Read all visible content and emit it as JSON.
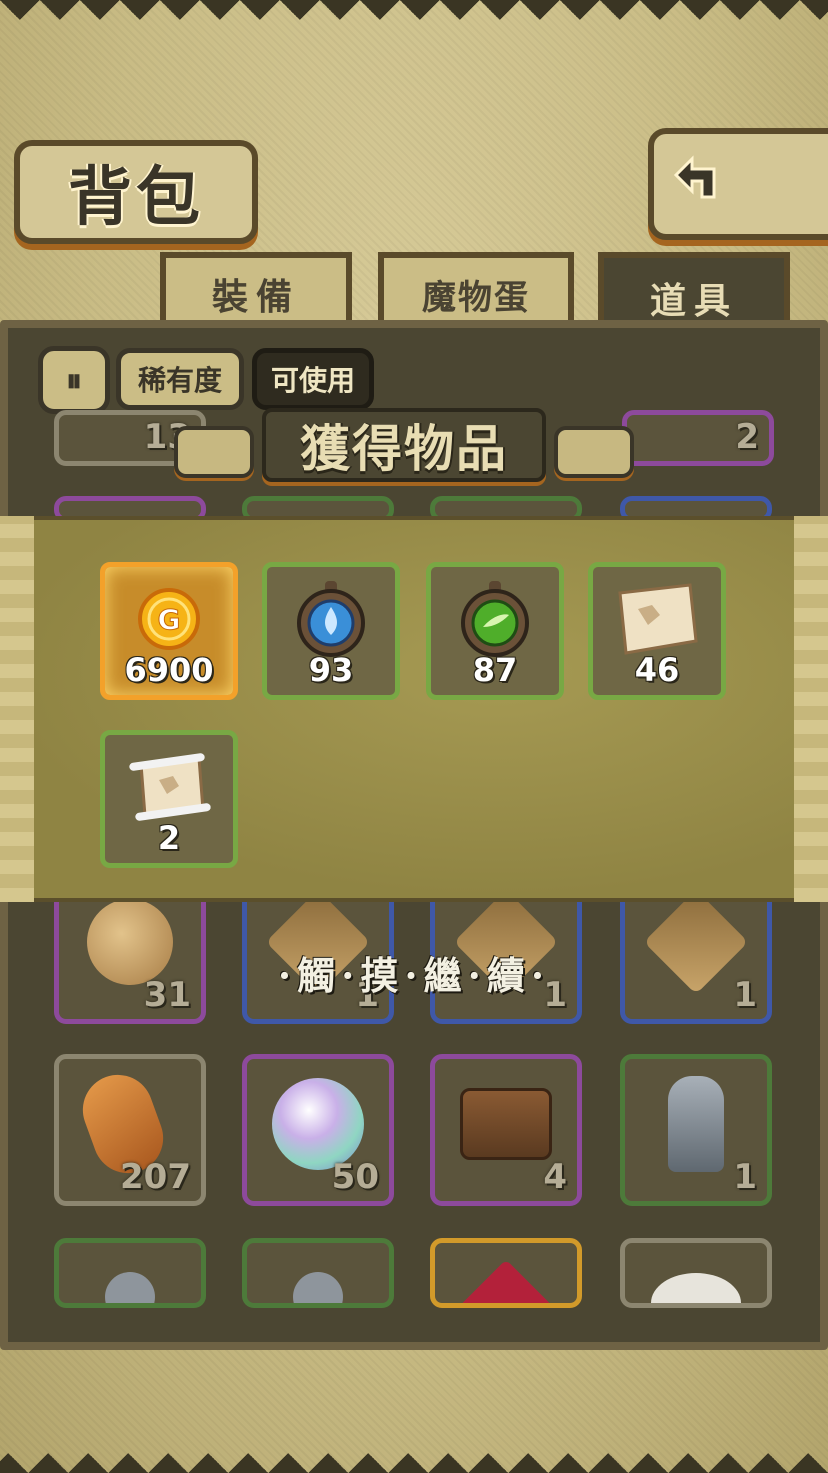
{
  "header": {
    "title": "背包",
    "back_icon": "return-arrow-icon"
  },
  "tabs": [
    {
      "label": "裝備",
      "active": false
    },
    {
      "label": "魔物蛋",
      "active": false
    },
    {
      "label": "道具",
      "active": true
    }
  ],
  "filters": {
    "toggle_icon": "sort-toggle-icon",
    "rarity_label": "稀有度",
    "usable_label": "可使用"
  },
  "inventory": {
    "row_top_partial": [
      {
        "qty": "13",
        "border": "grey"
      },
      {
        "qty": "2",
        "border": "purple"
      }
    ],
    "row_a": [
      {
        "qty": "31",
        "icon": "treasure-sack-icon",
        "border": "purple"
      },
      {
        "qty": "1",
        "icon": "monster-card-icon",
        "border": "blue"
      },
      {
        "qty": "1",
        "icon": "monster-card-icon",
        "border": "blue"
      },
      {
        "qty": "1",
        "icon": "monster-card-icon",
        "border": "blue"
      }
    ],
    "row_b": [
      {
        "qty": "207",
        "icon": "bread-icon",
        "border": "grey"
      },
      {
        "qty": "50",
        "icon": "rainbow-egg-icon",
        "border": "purple"
      },
      {
        "qty": "4",
        "icon": "treasure-chest-icon",
        "border": "purple"
      },
      {
        "qty": "1",
        "icon": "knight-statue-icon",
        "border": "green"
      }
    ],
    "row_c": [
      {
        "icon": "knight-figure-icon",
        "border": "green"
      },
      {
        "icon": "knight-figure-icon",
        "border": "green"
      },
      {
        "icon": "red-envelope-icon",
        "border": "gold"
      },
      {
        "icon": "white-sack-icon",
        "border": "grey"
      }
    ]
  },
  "reward_dialog": {
    "title": "獲得物品",
    "items": [
      {
        "qty": "6900",
        "icon": "gold-coin-icon",
        "highlight": true
      },
      {
        "qty": "93",
        "icon": "water-compass-icon"
      },
      {
        "qty": "87",
        "icon": "wind-compass-icon"
      },
      {
        "qty": "46",
        "icon": "torn-map-icon"
      },
      {
        "qty": "2",
        "icon": "scroll-map-icon"
      }
    ],
    "continue_text": "·觸·摸·繼·續·"
  },
  "colors": {
    "panel": "#4b4632",
    "parchment": "#cbbd86",
    "accent_orange": "#a5651f",
    "reward_border": "#78a844",
    "gold_border": "#f3a12a"
  }
}
